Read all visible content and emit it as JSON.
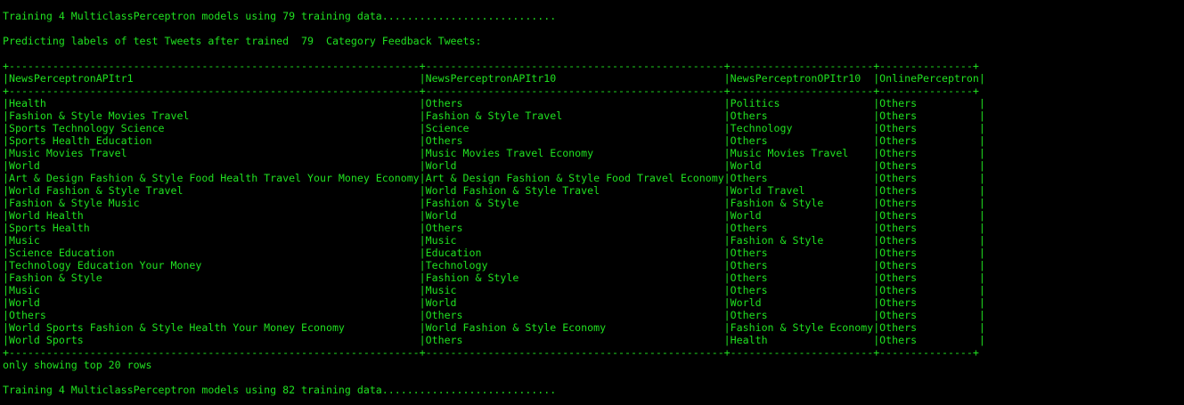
{
  "colors": {
    "background": "#000000",
    "text": "#20e020"
  },
  "terminal": {
    "lines": [
      "Training 4 MulticlassPerceptron models using 79 training data............................",
      "",
      "Predicting labels of test Tweets after trained  79  Category Feedback Tweets:",
      "",
      "+------------------------------------------------------------------+------------------------------------------------+-----------------------+---------------+",
      "|NewsPerceptronAPItr1                                              |NewsPerceptronAPItr10                           |NewsPerceptronOPItr10  |OnlinePerceptron|",
      "+------------------------------------------------------------------+------------------------------------------------+-----------------------+---------------+",
      "|Health                                                            |Others                                          |Politics               |Others          |",
      "|Fashion & Style Movies Travel                                     |Fashion & Style Travel                          |Others                 |Others          |",
      "|Sports Technology Science                                         |Science                                         |Technology             |Others          |",
      "|Sports Health Education                                           |Others                                          |Others                 |Others          |",
      "|Music Movies Travel                                               |Music Movies Travel Economy                     |Music Movies Travel    |Others          |",
      "|World                                                             |World                                           |World                  |Others          |",
      "|Art & Design Fashion & Style Food Health Travel Your Money Economy|Art & Design Fashion & Style Food Travel Economy|Others                 |Others          |",
      "|World Fashion & Style Travel                                      |World Fashion & Style Travel                    |World Travel           |Others          |",
      "|Fashion & Style Music                                             |Fashion & Style                                 |Fashion & Style        |Others          |",
      "|World Health                                                      |World                                           |World                  |Others          |",
      "|Sports Health                                                     |Others                                          |Others                 |Others          |",
      "|Music                                                             |Music                                           |Fashion & Style        |Others          |",
      "|Science Education                                                 |Education                                       |Others                 |Others          |",
      "|Technology Education Your Money                                   |Technology                                      |Others                 |Others          |",
      "|Fashion & Style                                                   |Fashion & Style                                 |Others                 |Others          |",
      "|Music                                                             |Music                                           |Others                 |Others          |",
      "|World                                                             |World                                           |World                  |Others          |",
      "|Others                                                            |Others                                          |Others                 |Others          |",
      "|World Sports Fashion & Style Health Your Money Economy            |World Fashion & Style Economy                   |Fashion & Style Economy|Others          |",
      "|World Sports                                                      |Others                                          |Health                 |Others          |",
      "+------------------------------------------------------------------+------------------------------------------------+-----------------------+---------------+",
      "only showing top 20 rows",
      "",
      "Training 4 MulticlassPerceptron models using 82 training data............................"
    ]
  }
}
